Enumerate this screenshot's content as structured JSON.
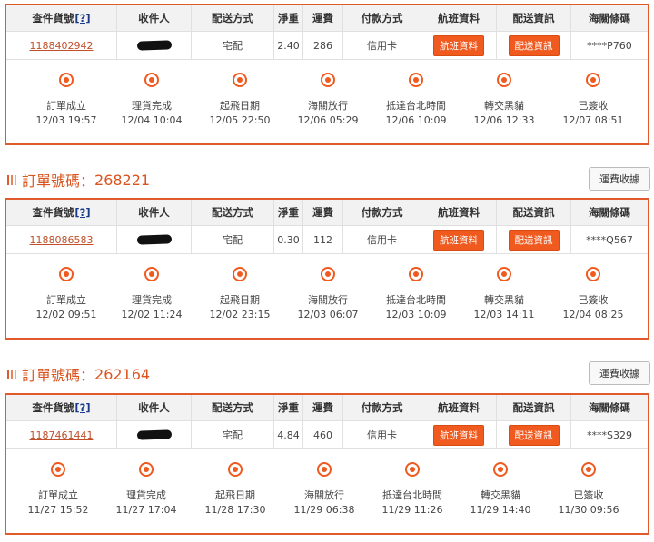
{
  "headers": [
    "查件貨號",
    "[?]",
    "收件人",
    "配送方式",
    "淨重",
    "運費",
    "付款方式",
    "航班資料",
    "配送資訊",
    "海關條碼"
  ],
  "flight_btn": "航班資料",
  "delivery_btn": "配送資訊",
  "order_label": "訂單號碼：",
  "fee_btn": "運費收據",
  "step_labels": [
    "訂單成立",
    "理貨完成",
    "起飛日期",
    "海關放行",
    "抵達台北時間",
    "轉交黑貓",
    "已簽收"
  ],
  "orders": [
    {
      "order_no": "",
      "tracking": "1188402942",
      "method": "宅配",
      "weight": "2.40",
      "fee": "286",
      "payment": "信用卡",
      "customs": "****P760",
      "times": [
        "12/03 19:57",
        "12/04 10:04",
        "12/05 22:50",
        "12/06 05:29",
        "12/06 10:09",
        "12/06 12:33",
        "12/07 08:51"
      ]
    },
    {
      "order_no": "268221",
      "tracking": "1188086583",
      "method": "宅配",
      "weight": "0.30",
      "fee": "112",
      "payment": "信用卡",
      "customs": "****Q567",
      "times": [
        "12/02 09:51",
        "12/02 11:24",
        "12/02 23:15",
        "12/03 06:07",
        "12/03 10:09",
        "12/03 14:11",
        "12/04 08:25"
      ]
    },
    {
      "order_no": "262164",
      "tracking": "1187461441",
      "method": "宅配",
      "weight": "4.84",
      "fee": "460",
      "payment": "信用卡",
      "customs": "****S329",
      "times": [
        "11/27 15:52",
        "11/27 17:04",
        "11/28 17:30",
        "11/29 06:38",
        "11/29 11:26",
        "11/29 14:40",
        "11/30 09:56"
      ]
    }
  ],
  "colors": {
    "accent": "#e05a2b",
    "button": "#f05a1f",
    "header_bg": "#f2f2f2"
  }
}
